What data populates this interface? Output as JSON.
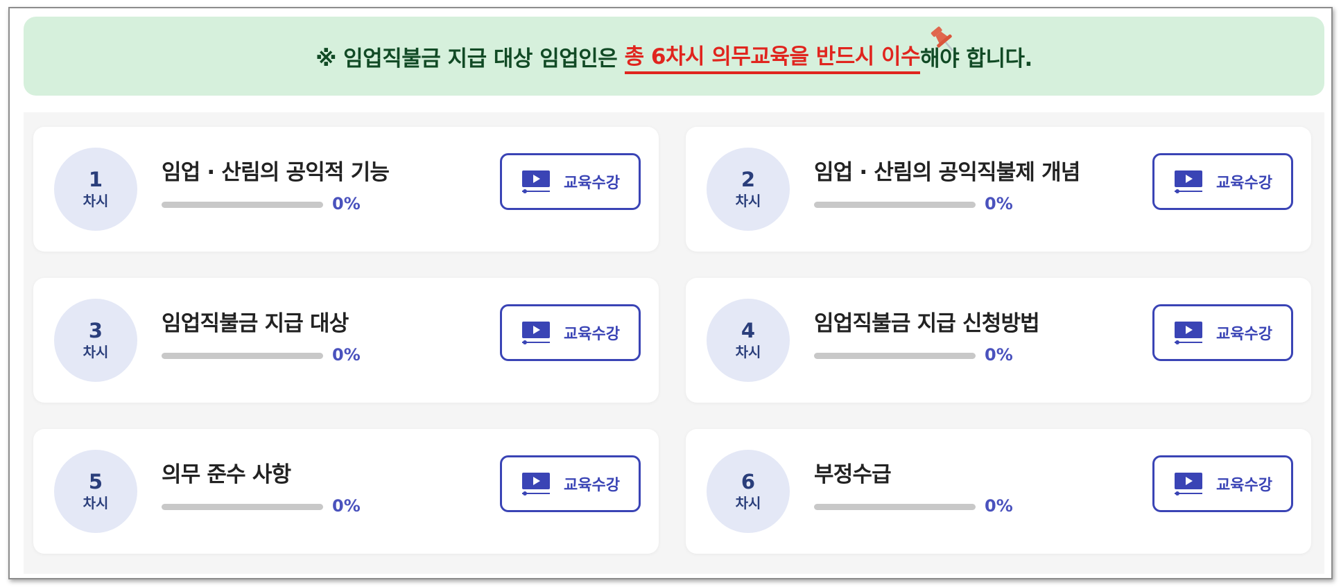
{
  "notice": {
    "prefix": "※ 임업직불금 지급 대상 임업인은 ",
    "highlight": "총 6차시 의무교육을 반드시 이수",
    "suffix": "해야 합니다."
  },
  "lessons": [
    {
      "num": "1",
      "unit": "차시",
      "title": "임업 · 산림의 공익적 기능",
      "progress": 0,
      "progress_label": "0%",
      "button_label": "교육수강"
    },
    {
      "num": "2",
      "unit": "차시",
      "title": "임업 · 산림의 공익직불제 개념",
      "progress": 0,
      "progress_label": "0%",
      "button_label": "교육수강"
    },
    {
      "num": "3",
      "unit": "차시",
      "title": "임업직불금 지급 대상",
      "progress": 0,
      "progress_label": "0%",
      "button_label": "교육수강"
    },
    {
      "num": "4",
      "unit": "차시",
      "title": "임업직불금 지급 신청방법",
      "progress": 0,
      "progress_label": "0%",
      "button_label": "교육수강"
    },
    {
      "num": "5",
      "unit": "차시",
      "title": "의무 준수 사항",
      "progress": 0,
      "progress_label": "0%",
      "button_label": "교육수강"
    },
    {
      "num": "6",
      "unit": "차시",
      "title": "부정수급",
      "progress": 0,
      "progress_label": "0%",
      "button_label": "교육수강"
    }
  ],
  "icons": {
    "notice_pin": "pushpin-icon",
    "button": "video-play-icon"
  },
  "colors": {
    "accent": "#3a44b5",
    "highlight": "#e0251e",
    "notice_bg": "#d6f0dc",
    "notice_text": "#114a25"
  }
}
